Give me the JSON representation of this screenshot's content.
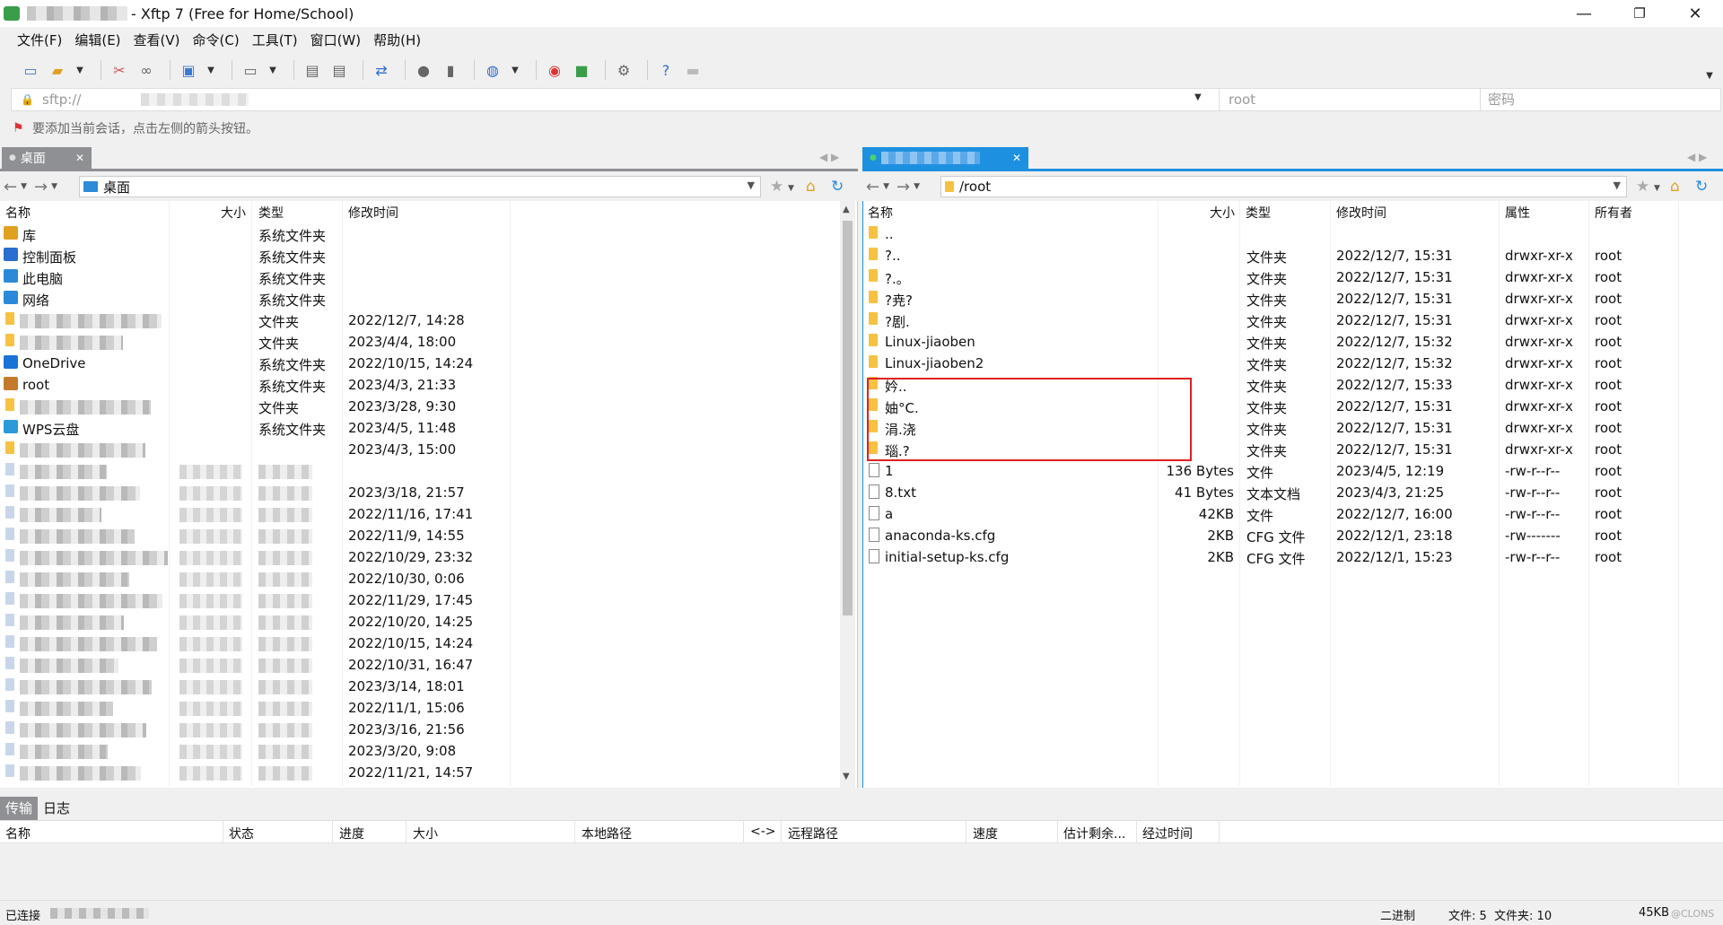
{
  "window": {
    "title": "- Xftp 7 (Free for Home/School)",
    "minimize": "—",
    "maximize": "❐",
    "close": "✕"
  },
  "menu": [
    "文件(F)",
    "编辑(E)",
    "查看(V)",
    "命令(C)",
    "工具(T)",
    "窗口(W)",
    "帮助(H)"
  ],
  "address": {
    "value": "sftp://",
    "username": "root",
    "password_placeholder": "密码"
  },
  "hint": "要添加当前会话，点击左侧的箭头按钮。",
  "left_panel": {
    "tab_label": "桌面",
    "path": "桌面",
    "columns": [
      "名称",
      "大小",
      "类型",
      "修改时间"
    ],
    "rows": [
      {
        "name": "库",
        "size": "",
        "type": "系统文件夹",
        "modified": "",
        "icon": "library-icon"
      },
      {
        "name": "控制面板",
        "size": "",
        "type": "系统文件夹",
        "modified": "",
        "icon": "control-panel-icon"
      },
      {
        "name": "此电脑",
        "size": "",
        "type": "系统文件夹",
        "modified": "",
        "icon": "computer-icon"
      },
      {
        "name": "网络",
        "size": "",
        "type": "系统文件夹",
        "modified": "",
        "icon": "network-icon"
      },
      {
        "name": "",
        "size": "",
        "type": "文件夹",
        "modified": "2022/12/7, 14:28",
        "icon": "folder-icon"
      },
      {
        "name": "",
        "size": "",
        "type": "文件夹",
        "modified": "2023/4/4, 18:00",
        "icon": "folder-icon"
      },
      {
        "name": "OneDrive",
        "size": "",
        "type": "系统文件夹",
        "modified": "2022/10/15, 14:24",
        "icon": "onedrive-icon"
      },
      {
        "name": "root",
        "size": "",
        "type": "系统文件夹",
        "modified": "2023/4/3, 21:33",
        "icon": "user-icon"
      },
      {
        "name": "",
        "size": "",
        "type": "文件夹",
        "modified": "2023/3/28, 9:30",
        "icon": "folder-icon"
      },
      {
        "name": "WPS云盘",
        "size": "",
        "type": "系统文件夹",
        "modified": "2023/4/5, 11:48",
        "icon": "cloud-icon"
      },
      {
        "name": "",
        "size": "",
        "type": "",
        "modified": "2023/4/3, 15:00",
        "icon": "folder-icon"
      },
      {
        "name": "",
        "size": "",
        "type": "",
        "modified": "",
        "icon": "file-icon"
      },
      {
        "name": "",
        "size": "",
        "type": "",
        "modified": "2023/3/18, 21:57",
        "icon": "file-icon"
      },
      {
        "name": "",
        "size": "",
        "type": "",
        "modified": "2022/11/16, 17:41",
        "icon": "file-icon"
      },
      {
        "name": "",
        "size": "",
        "type": "",
        "modified": "2022/11/9, 14:55",
        "icon": "file-icon"
      },
      {
        "name": "",
        "size": "",
        "type": "",
        "modified": "2022/10/29, 23:32",
        "icon": "file-icon"
      },
      {
        "name": "",
        "size": "",
        "type": "",
        "modified": "2022/10/30, 0:06",
        "icon": "file-icon"
      },
      {
        "name": "",
        "size": "",
        "type": "",
        "modified": "2022/11/29, 17:45",
        "icon": "file-icon"
      },
      {
        "name": "",
        "size": "",
        "type": "",
        "modified": "2022/10/20, 14:25",
        "icon": "file-icon"
      },
      {
        "name": "",
        "size": "",
        "type": "",
        "modified": "2022/10/15, 14:24",
        "icon": "file-icon"
      },
      {
        "name": "",
        "size": "",
        "type": "",
        "modified": "2022/10/31, 16:47",
        "icon": "file-icon"
      },
      {
        "name": "",
        "size": "",
        "type": "",
        "modified": "2023/3/14, 18:01",
        "icon": "file-icon"
      },
      {
        "name": "",
        "size": "",
        "type": "",
        "modified": "2022/11/1, 15:06",
        "icon": "file-icon"
      },
      {
        "name": "",
        "size": "",
        "type": "",
        "modified": "2023/3/16, 21:56",
        "icon": "file-icon"
      },
      {
        "name": "",
        "size": "",
        "type": "",
        "modified": "2023/3/20, 9:08",
        "icon": "file-icon"
      },
      {
        "name": "",
        "size": "",
        "type": "",
        "modified": "2022/11/21, 14:57",
        "icon": "file-icon"
      }
    ]
  },
  "right_panel": {
    "tab_label": "",
    "path": "/root",
    "columns": [
      "名称",
      "大小",
      "类型",
      "修改时间",
      "属性",
      "所有者"
    ],
    "rows": [
      {
        "name": "..",
        "size": "",
        "type": "",
        "modified": "",
        "attr": "",
        "owner": "",
        "icon": "folder-icon"
      },
      {
        "name": "?..",
        "size": "",
        "type": "文件夹",
        "modified": "2022/12/7, 15:31",
        "attr": "drwxr-xr-x",
        "owner": "root",
        "icon": "folder-icon"
      },
      {
        "name": "?.。",
        "size": "",
        "type": "文件夹",
        "modified": "2022/12/7, 15:31",
        "attr": "drwxr-xr-x",
        "owner": "root",
        "icon": "folder-icon"
      },
      {
        "name": "?尭?",
        "size": "",
        "type": "文件夹",
        "modified": "2022/12/7, 15:31",
        "attr": "drwxr-xr-x",
        "owner": "root",
        "icon": "folder-icon"
      },
      {
        "name": "?剧.",
        "size": "",
        "type": "文件夹",
        "modified": "2022/12/7, 15:31",
        "attr": "drwxr-xr-x",
        "owner": "root",
        "icon": "folder-icon"
      },
      {
        "name": "Linux-jiaoben",
        "size": "",
        "type": "文件夹",
        "modified": "2022/12/7, 15:32",
        "attr": "drwxr-xr-x",
        "owner": "root",
        "icon": "folder-icon"
      },
      {
        "name": "Linux-jiaoben2",
        "size": "",
        "type": "文件夹",
        "modified": "2022/12/7, 15:32",
        "attr": "drwxr-xr-x",
        "owner": "root",
        "icon": "folder-icon"
      },
      {
        "name": "妗..",
        "size": "",
        "type": "文件夹",
        "modified": "2022/12/7, 15:33",
        "attr": "drwxr-xr-x",
        "owner": "root",
        "icon": "folder-icon"
      },
      {
        "name": "妯°C.",
        "size": "",
        "type": "文件夹",
        "modified": "2022/12/7, 15:31",
        "attr": "drwxr-xr-x",
        "owner": "root",
        "icon": "folder-icon"
      },
      {
        "name": "涓.浇",
        "size": "",
        "type": "文件夹",
        "modified": "2022/12/7, 15:31",
        "attr": "drwxr-xr-x",
        "owner": "root",
        "icon": "folder-icon"
      },
      {
        "name": "瑙.?",
        "size": "",
        "type": "文件夹",
        "modified": "2022/12/7, 15:31",
        "attr": "drwxr-xr-x",
        "owner": "root",
        "icon": "folder-icon"
      },
      {
        "name": "1",
        "size": "136 Bytes",
        "type": "文件",
        "modified": "2023/4/5, 12:19",
        "attr": "-rw-r--r--",
        "owner": "root",
        "icon": "file-icon"
      },
      {
        "name": "8.txt",
        "size": "41 Bytes",
        "type": "文本文档",
        "modified": "2023/4/3, 21:25",
        "attr": "-rw-r--r--",
        "owner": "root",
        "icon": "file-icon"
      },
      {
        "name": "a",
        "size": "42KB",
        "type": "文件",
        "modified": "2022/12/7, 16:00",
        "attr": "-rw-r--r--",
        "owner": "root",
        "icon": "file-icon"
      },
      {
        "name": "anaconda-ks.cfg",
        "size": "2KB",
        "type": "CFG 文件",
        "modified": "2022/12/1, 23:18",
        "attr": "-rw-------",
        "owner": "root",
        "icon": "file-icon"
      },
      {
        "name": "initial-setup-ks.cfg",
        "size": "2KB",
        "type": "CFG 文件",
        "modified": "2022/12/1, 15:23",
        "attr": "-rw-r--r--",
        "owner": "root",
        "icon": "file-icon"
      }
    ]
  },
  "bottom": {
    "tabs": [
      "传输",
      "日志"
    ],
    "columns": [
      "名称",
      "状态",
      "进度",
      "大小",
      "本地路径",
      "<->",
      "远程路径",
      "速度",
      "估计剩余...",
      "经过时间"
    ]
  },
  "status": {
    "connected": "已连接",
    "mode": "二进制",
    "counts": "文件: 5  文件夹: 10",
    "size": "45KB",
    "watermark": "@CLONS"
  }
}
